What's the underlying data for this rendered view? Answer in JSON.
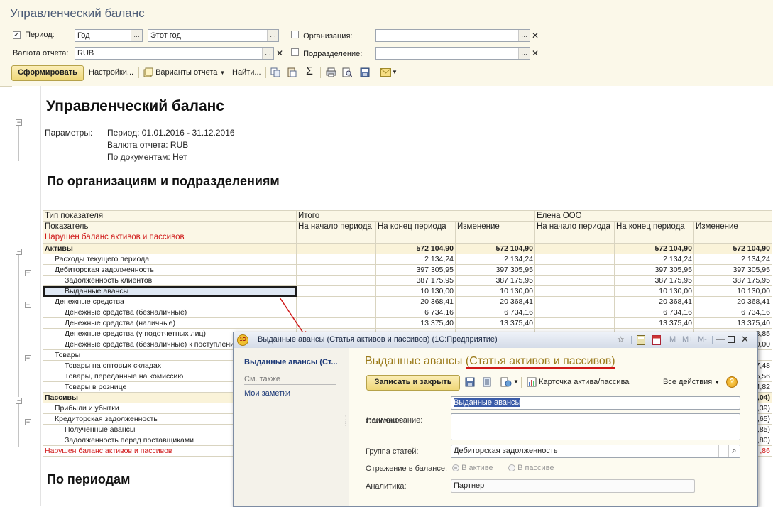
{
  "app": {
    "title": "Управленческий баланс"
  },
  "filters": {
    "period_label": "Период:",
    "period_checked": true,
    "period_type": "Год",
    "period_value": "Этот год",
    "currency_label": "Валюта отчета:",
    "currency_value": "RUB",
    "org_label": "Организация:",
    "org_value": "",
    "dept_label": "Подразделение:",
    "dept_value": ""
  },
  "toolbar": {
    "form_label": "Сформировать",
    "settings_label": "Настройки...",
    "variants_label": "Варианты отчета",
    "find_label": "Найти..."
  },
  "report": {
    "title": "Управленческий баланс",
    "params_label": "Параметры:",
    "params": [
      "Период: 01.01.2016 - 31.12.2016",
      "Валюта отчета: RUB",
      "По документам: Нет"
    ],
    "section1": "По организациям и подразделениям",
    "section2": "По периодам",
    "header": {
      "type_col": "Тип показателя",
      "total_group": "Итого",
      "org_group": "Елена ООО",
      "indicator_col": "Показатель",
      "warning": "Нарушен баланс активов и пассивов",
      "start": "На начало периода",
      "end": "На конец периода",
      "change": "Изменение"
    },
    "rows": [
      {
        "name": "Активы",
        "indent": 0,
        "kind": "grp",
        "v": [
          "",
          "572 104,90",
          "572 104,90",
          "",
          "572 104,90",
          "572 104,90"
        ]
      },
      {
        "name": "Расходы текущего периода",
        "indent": 1,
        "kind": "",
        "v": [
          "",
          "2 134,24",
          "2 134,24",
          "",
          "2 134,24",
          "2 134,24"
        ]
      },
      {
        "name": "Дебиторская задолженность",
        "indent": 1,
        "kind": "",
        "v": [
          "",
          "397 305,95",
          "397 305,95",
          "",
          "397 305,95",
          "397 305,95"
        ]
      },
      {
        "name": "Задолженность клиентов",
        "indent": 2,
        "kind": "",
        "v": [
          "",
          "387 175,95",
          "387 175,95",
          "",
          "387 175,95",
          "387 175,95"
        ]
      },
      {
        "name": "Выданные авансы",
        "indent": 2,
        "kind": "sel",
        "v": [
          "",
          "10 130,00",
          "10 130,00",
          "",
          "10 130,00",
          "10 130,00"
        ]
      },
      {
        "name": "Денежные средства",
        "indent": 1,
        "kind": "",
        "v": [
          "",
          "20 368,41",
          "20 368,41",
          "",
          "20 368,41",
          "20 368,41"
        ]
      },
      {
        "name": "Денежные средства (безналичные)",
        "indent": 2,
        "kind": "",
        "v": [
          "",
          "6 734,16",
          "6 734,16",
          "",
          "6 734,16",
          "6 734,16"
        ]
      },
      {
        "name": "Денежные средства (наличные)",
        "indent": 2,
        "kind": "",
        "v": [
          "",
          "13 375,40",
          "13 375,40",
          "",
          "13 375,40",
          "13 375,40"
        ]
      },
      {
        "name": "Денежные средства (у подотчетных лиц)",
        "indent": 2,
        "kind": "",
        "v": [
          "",
          "",
          "",
          "",
          "",
          "8,85"
        ]
      },
      {
        "name": "Денежные средства (безналичные) к поступлению",
        "indent": 2,
        "kind": "",
        "v": [
          "",
          "",
          "",
          "",
          "",
          "0,00"
        ]
      },
      {
        "name": "Товары",
        "indent": 1,
        "kind": "",
        "v": [
          "",
          "",
          "",
          "",
          "",
          ""
        ]
      },
      {
        "name": "Товары на оптовых складах",
        "indent": 2,
        "kind": "",
        "v": [
          "",
          "",
          "",
          "",
          "",
          "7,48"
        ]
      },
      {
        "name": "Товары, переданные на комиссию",
        "indent": 2,
        "kind": "",
        "v": [
          "",
          "",
          "",
          "",
          "",
          "5,56"
        ]
      },
      {
        "name": "Товары в рознице",
        "indent": 2,
        "kind": "",
        "v": [
          "",
          "",
          "",
          "",
          "",
          "4,82"
        ]
      },
      {
        "name": "Пассивы",
        "indent": 0,
        "kind": "grp",
        "v": [
          "",
          "",
          "",
          "",
          "",
          ",04)"
        ]
      },
      {
        "name": "Прибыли и убытки",
        "indent": 1,
        "kind": "",
        "v": [
          "",
          "",
          "",
          "",
          "",
          ",39)"
        ]
      },
      {
        "name": "Кредиторская задолженность",
        "indent": 1,
        "kind": "",
        "v": [
          "",
          "",
          "",
          "",
          "",
          ",65)"
        ]
      },
      {
        "name": "Полученные авансы",
        "indent": 2,
        "kind": "",
        "v": [
          "",
          "",
          "",
          "",
          "",
          ",85)"
        ]
      },
      {
        "name": "Задолженность перед поставщиками",
        "indent": 2,
        "kind": "",
        "v": [
          "",
          "",
          "",
          "",
          "",
          ",80)"
        ]
      },
      {
        "name": "Нарушен баланс активов и пассивов",
        "indent": 0,
        "kind": "red",
        "v": [
          "",
          "",
          "",
          "",
          "",
          ",86"
        ]
      }
    ]
  },
  "dialog": {
    "window_title": "Выданные авансы (Статья активов и пассивов)  (1С:Предприятие)",
    "nav_current": "Выданные авансы (Ст...",
    "nav_see_also": "См. также",
    "nav_notes": "Мои заметки",
    "heading_name": "Выданные авансы",
    "heading_kind": "(Статья активов и пассивов)",
    "save_close_label": "Записать и закрыть",
    "card_label": "Карточка актива/пассива",
    "all_actions_label": "Все действия",
    "name_label": "Наименование:",
    "name_value": "Выданные авансы",
    "desc_label": "Описание:",
    "desc_value": "",
    "group_label": "Группа статей:",
    "group_value": "Дебиторская задолженность",
    "balance_label": "Отражение в балансе:",
    "balance_assets": "В активе",
    "balance_liabilities": "В пассиве",
    "analytics_label": "Аналитика:",
    "analytics_value": "Партнер",
    "tb_m": "M",
    "tb_mplus": "M+",
    "tb_mminus": "M-"
  },
  "colors": {
    "accent_gold": "#f0d67a",
    "warning_red": "#d01818",
    "heading_gold": "#9a7a1a"
  }
}
